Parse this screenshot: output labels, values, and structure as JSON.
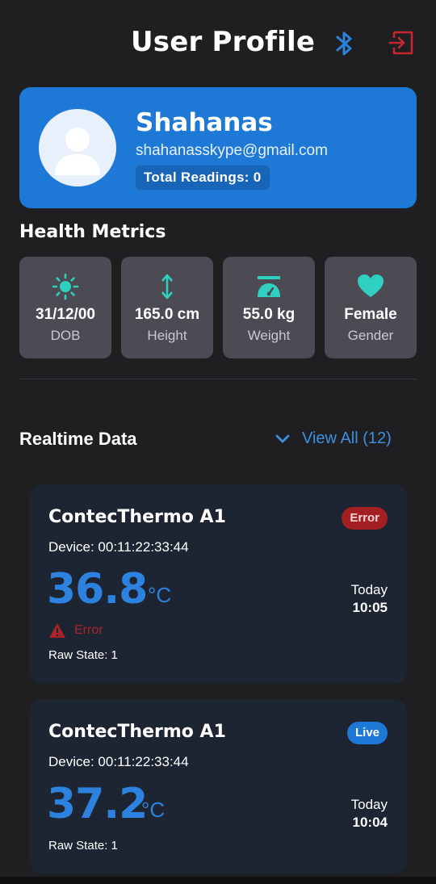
{
  "header": {
    "title": "User Profile"
  },
  "profile": {
    "name": "Shahanas",
    "email": "shahanasskype@gmail.com",
    "total_readings": "Total Readings: 0"
  },
  "health_metrics": {
    "title": "Health Metrics",
    "items": [
      {
        "icon": "sun-icon",
        "value": "31/12/00",
        "label": "DOB"
      },
      {
        "icon": "height-arrows-icon",
        "value": "165.0 cm",
        "label": "Height"
      },
      {
        "icon": "weight-scale-icon",
        "value": "55.0 kg",
        "label": "Weight"
      },
      {
        "icon": "heart-icon",
        "value": "Female",
        "label": "Gender"
      }
    ]
  },
  "realtime": {
    "title": "Realtime Data",
    "view_all": "View All (12)",
    "readings": [
      {
        "device_name": "ContecThermo A1",
        "status": "Error",
        "device_id": "Device: 00:11:22:33:44",
        "temperature": "36.8",
        "unit": "°C",
        "day": "Today",
        "time": "10:05",
        "error_text": "Error",
        "raw_state": "Raw State: 1"
      },
      {
        "device_name": "ContecThermo A1",
        "status": "Live",
        "device_id": "Device: 00:11:22:33:44",
        "temperature": "37.2",
        "unit": "°C",
        "day": "Today",
        "time": "10:04",
        "raw_state": "Raw State: 1"
      }
    ]
  },
  "colors": {
    "background": "#1f1f21",
    "accent": "#1e78d6",
    "teal_icon": "#2fd0c0",
    "error": "#a41f21",
    "card": "#1d2533",
    "metric_tile": "#4c4a52"
  }
}
